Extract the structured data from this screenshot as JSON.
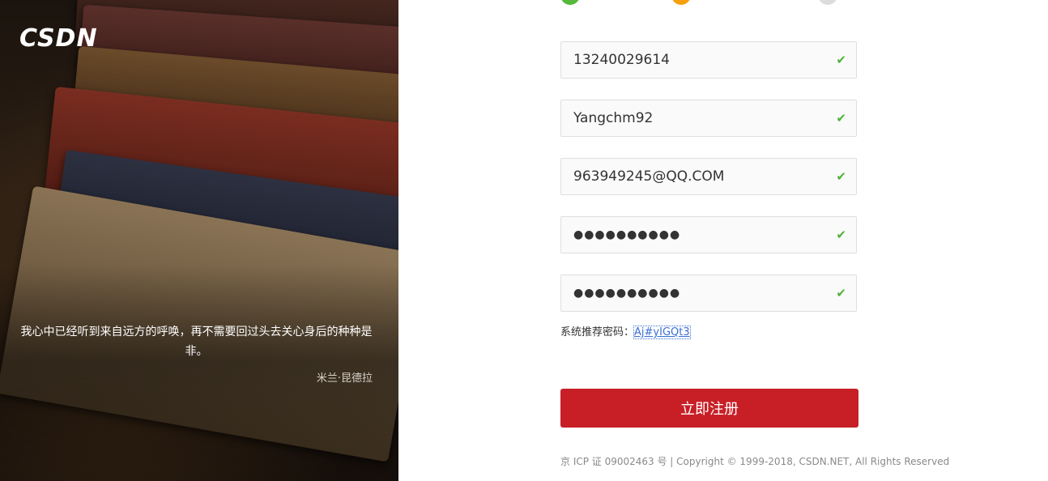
{
  "brand": {
    "logo_text": "CSDN"
  },
  "quote": {
    "text": "我心中已经听到来自远方的呼唤，再不需要回过头去关心身后的种种是非。",
    "author": "米兰·昆德拉"
  },
  "steps": {
    "colors": [
      "#56b83d",
      "#f6a010",
      "#dcdcdc"
    ]
  },
  "form": {
    "phone": "13240029614",
    "username": "Yangchm92",
    "email": "963949245@QQ.COM",
    "password": "●●●●●●●●●●",
    "confirm_password": "●●●●●●●●●●",
    "valid_icon": "✔",
    "suggested_label": "系统推荐密码：",
    "suggested_password": "Aj#yIGQt3",
    "submit_label": "立即注册"
  },
  "footer": {
    "text": "京 ICP 证 09002463 号 | Copyright © 1999-2018, CSDN.NET, All Rights Reserved"
  },
  "colors": {
    "accent": "#c81f26",
    "valid": "#4eb33a",
    "link": "#3b6fd1"
  }
}
